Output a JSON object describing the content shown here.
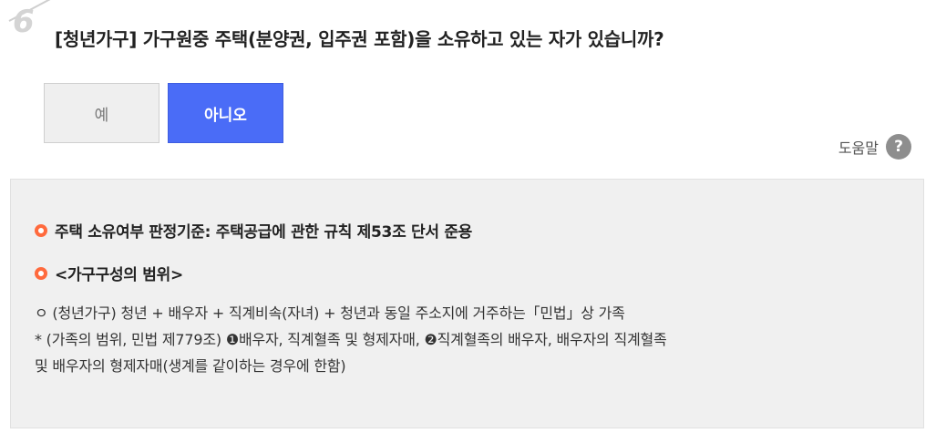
{
  "question": {
    "number": "6",
    "title": "[청년가구] 가구원중 주택(분양권, 입주권 포함)을 소유하고 있는 자가 있습니까?"
  },
  "options": {
    "yes_label": "예",
    "no_label": "아니오",
    "selected": "no"
  },
  "help": {
    "label": "도움말",
    "icon": "?"
  },
  "info": {
    "criteria": "주택 소유여부 판정기준: 주택공급에 관한 규칙 제53조 단서 준용",
    "scope_heading": "<가구구성의 범위>",
    "lines": [
      "ㅇ (청년가구) 청년 + 배우자 + 직계비속(자녀) + 청년과 동일 주소지에 거주하는「민법」상 가족",
      "* (가족의 범위, 민법 제779조) ❶배우자, 직계혈족 및 형제자매, ❷직계혈족의 배우자, 배우자의 직계혈족",
      "및 배우자의 형제자매(생계를 같이하는 경우에 한함)"
    ]
  },
  "colors": {
    "selected_button": "#4a6cf7",
    "bullet": "#ff6a3d",
    "panel": "#f0f0f0"
  }
}
